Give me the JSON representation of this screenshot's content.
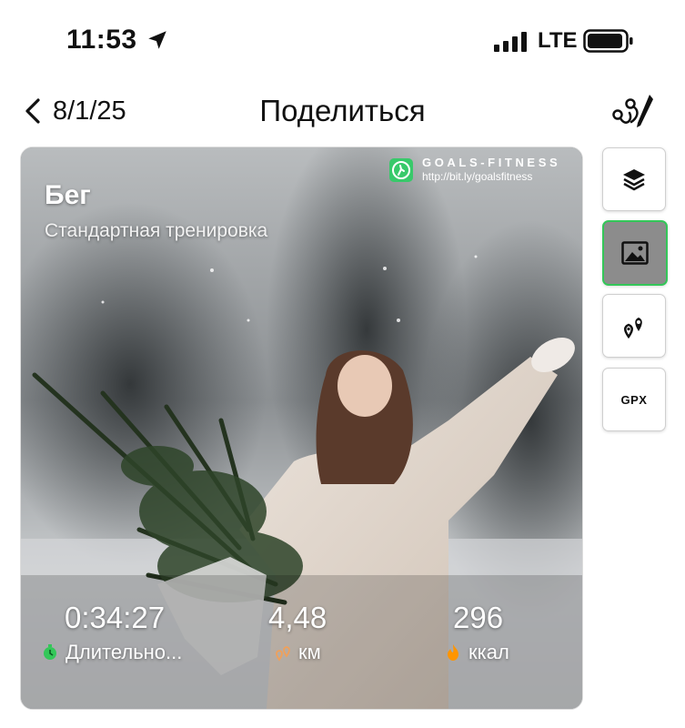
{
  "status_bar": {
    "time": "11:53",
    "network": "LTE"
  },
  "nav": {
    "date": "8/1/25",
    "title": "Поделиться"
  },
  "card": {
    "sport": "Бег",
    "workout_type": "Стандартная тренировка",
    "brand": {
      "name": "GOALS-FITNESS",
      "url": "http://bit.ly/goalsfitness"
    },
    "stats": {
      "duration": {
        "value": "0:34:27",
        "label": "Длительно...",
        "icon": "clock-icon",
        "color": "#34c759"
      },
      "distance": {
        "value": "4,48",
        "label": "км",
        "icon": "pins-icon",
        "color": "#f0a05a"
      },
      "calories": {
        "value": "296",
        "label": "ккал",
        "icon": "flame-icon",
        "color": "#ff9500"
      }
    }
  },
  "tools": [
    {
      "name": "layers",
      "icon": "layers-icon"
    },
    {
      "name": "photo",
      "icon": "image-icon",
      "active": true,
      "accent": "#34c759"
    },
    {
      "name": "map-pins",
      "icon": "map-pins-icon"
    },
    {
      "name": "gpx",
      "label": "GPX"
    }
  ]
}
